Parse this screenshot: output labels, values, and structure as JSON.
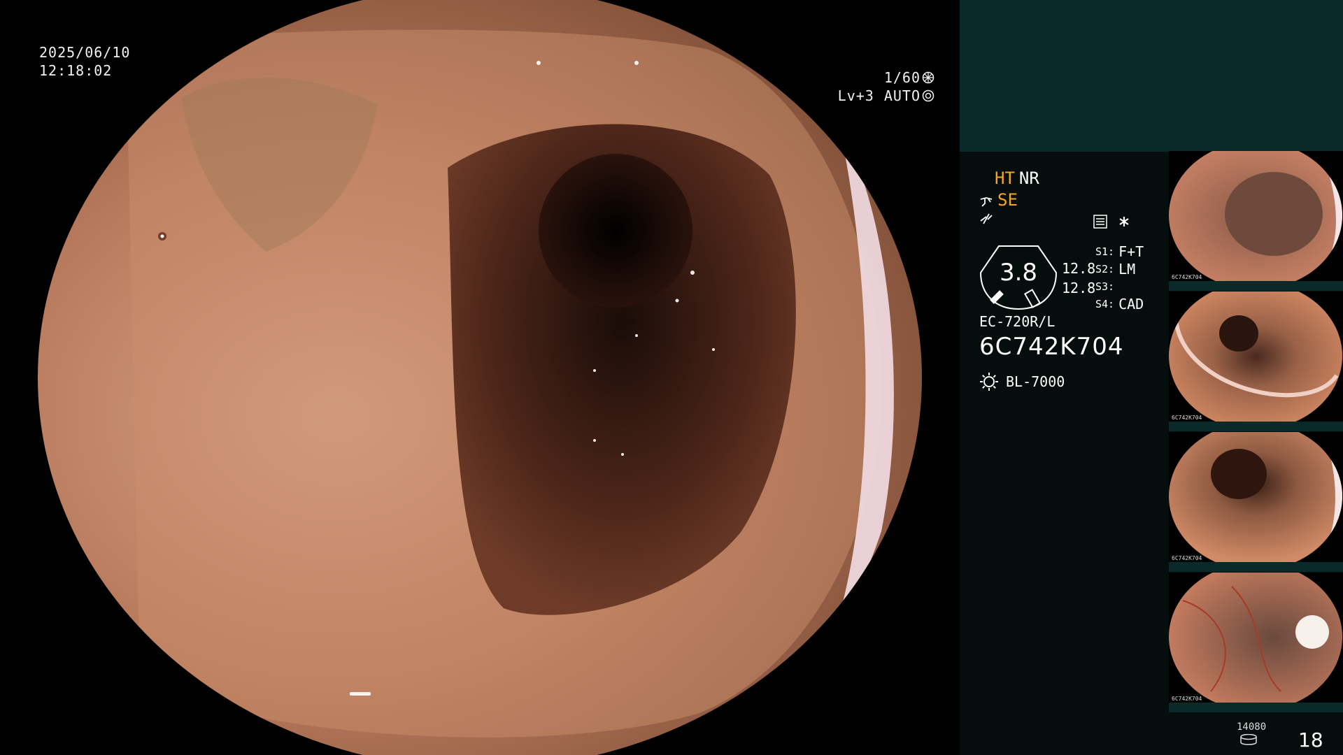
{
  "video": {
    "date": "2025/06/10",
    "time": "12:18:02",
    "shutter": "1/60",
    "brightness_level": "Lv+3",
    "iris_mode": "AUTO"
  },
  "panel": {
    "status": {
      "ht": "HT",
      "nr": "NR",
      "se": "SE"
    },
    "gauge_value": "3.8",
    "gauge_reading_1": "12.8",
    "gauge_reading_2": "12.8",
    "settings": [
      {
        "key": "S1:",
        "value": "F+T"
      },
      {
        "key": "S2:",
        "value": "LM"
      },
      {
        "key": "S3:",
        "value": ""
      },
      {
        "key": "S4:",
        "value": "CAD"
      }
    ],
    "scope_model": "EC-720R/L",
    "scope_serial": "6C742K704",
    "light_source": "BL-7000",
    "thumbnails": [
      {
        "label": "6C742K704"
      },
      {
        "label": "6C742K704"
      },
      {
        "label": "6C742K704"
      },
      {
        "label": "6C742K704"
      }
    ],
    "footer_count": "14080",
    "footer_page": "18"
  },
  "colors": {
    "panel_bg": "#060d0d",
    "panel_top": "#0a2a2a",
    "amber": "#f5a623"
  }
}
